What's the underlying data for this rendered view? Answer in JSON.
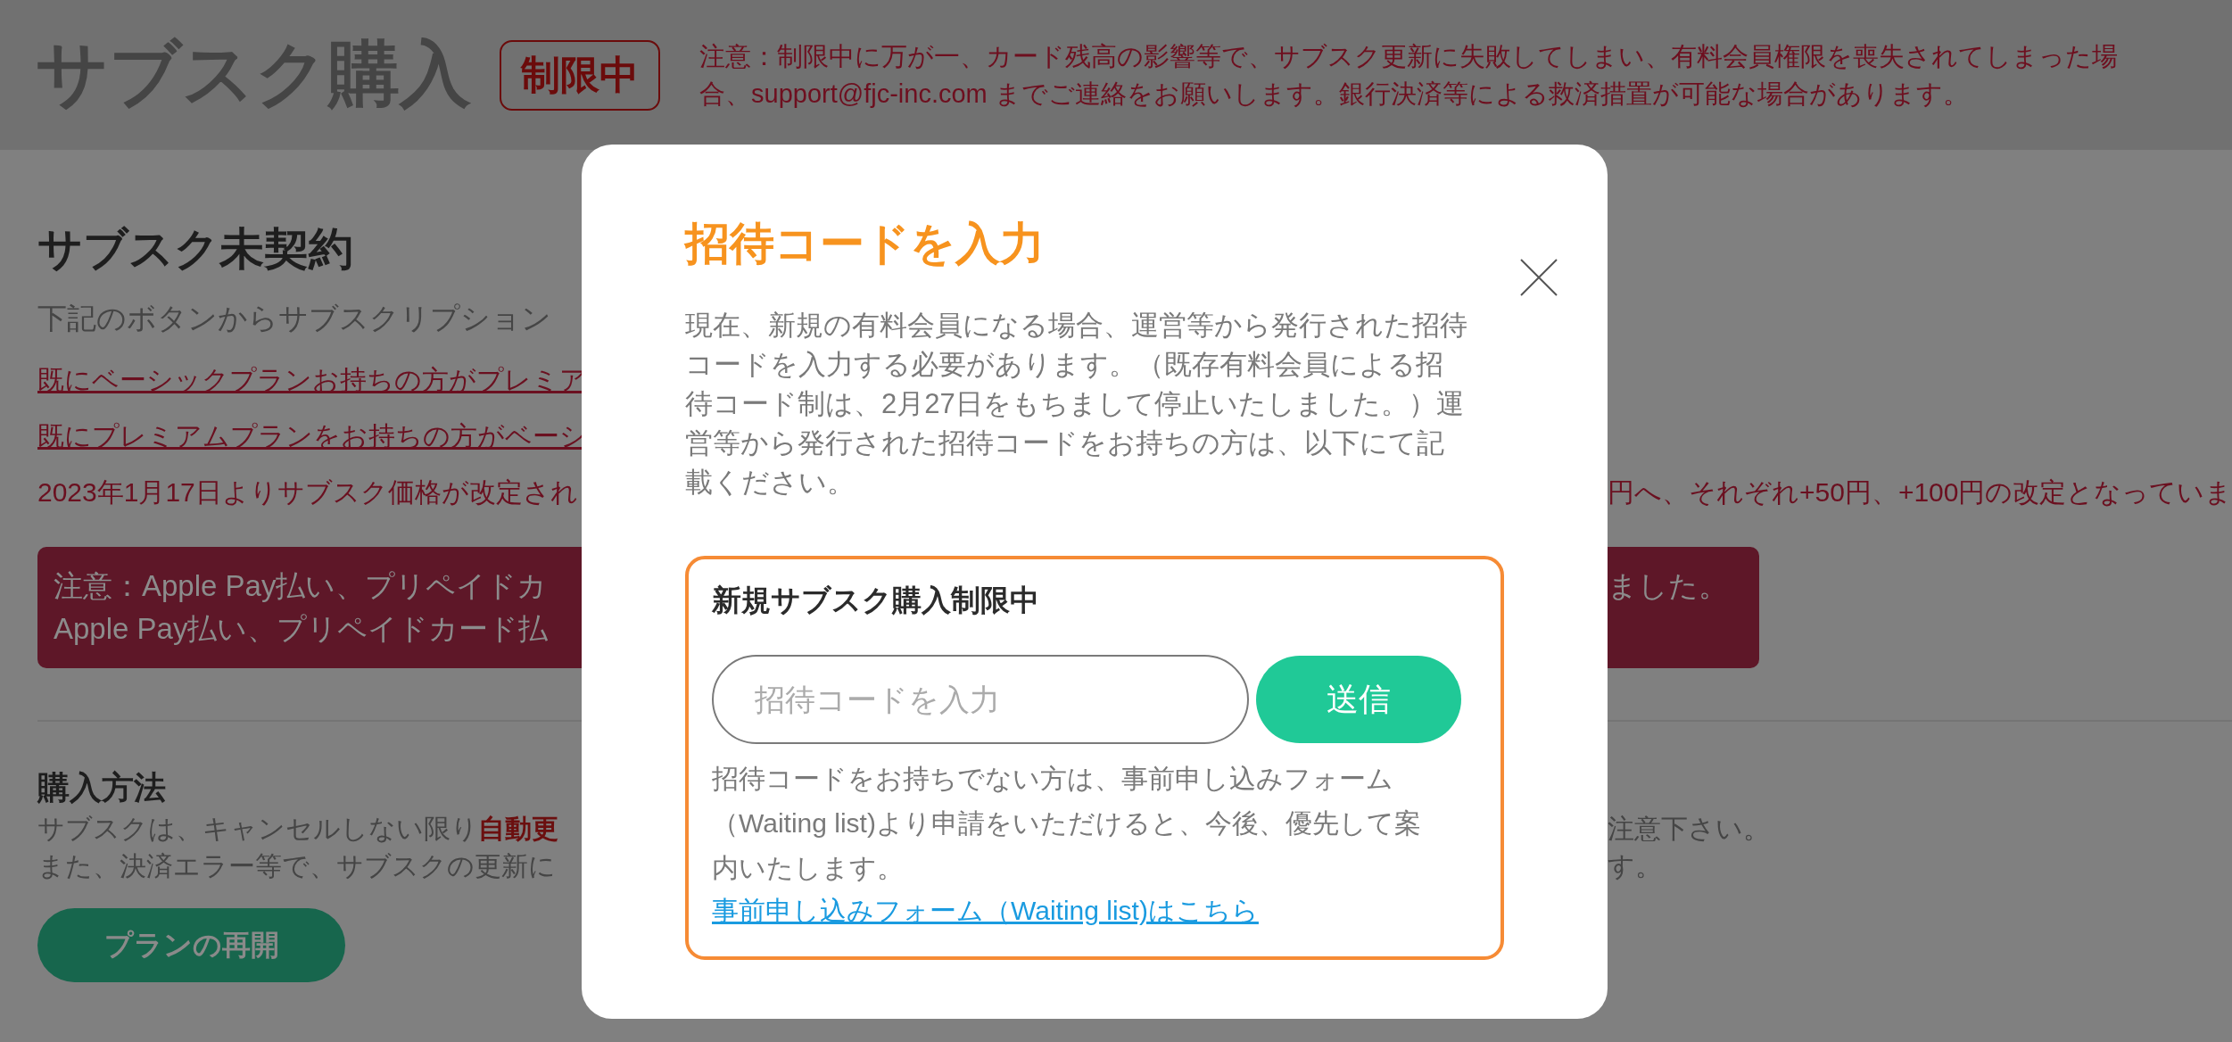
{
  "header": {
    "title": "サブスク購入",
    "badge": "制限中",
    "notice": "注意：制限中に万が一、カード残高の影響等で、サブスク更新に失敗してしまい、有料会員権限を喪失されてしまった場合、support@fjc-inc.com までご連絡をお願いします。銀行決済等による救済措置が可能な場合があります。"
  },
  "main": {
    "heading": "サブスク未契約",
    "intro": "下記のボタンからサブスクリプション",
    "links": [
      "既にベーシックプランお持ちの方がプレミア",
      "既にプレミアムプランをお持ちの方がベーシ"
    ],
    "price_notice": {
      "left": "2023年1月17日よりサブスク価格が改定され",
      "right": "円へ、それぞれ+50円、+100円の改定となっていま"
    },
    "alert": {
      "lines": [
        {
          "left": "注意：Apple Pay払い、プリペイドカ",
          "right": "ました。"
        },
        {
          "left": "Apple Pay払い、プリペイドカード払"
        }
      ]
    },
    "purchase": {
      "heading": "購入方法",
      "lines": [
        {
          "left": "サブスクは、キャンセルしない限り**自動更**",
          "right": "注意下さい。"
        },
        {
          "left": "また、決済エラー等で、サブスクの更新に",
          "right": "す。"
        }
      ],
      "button": "プランの再開"
    }
  },
  "modal": {
    "title": "招待コードを入力",
    "description": "現在、新規の有料会員になる場合、運営等から発行された招待コードを入力する必要があります。（既存有料会員による招待コード制は、2月27日をもちまして停止いたしました。）運営等から発行された招待コードをお持ちの方は、以下にて記載ください。",
    "box": {
      "heading": "新規サブスク購入制限中",
      "code_field": {
        "placeholder": "招待コードを入力"
      },
      "submit": "送信",
      "note": "招待コードをお持ちでない方は、事前申し込みフォーム（Waiting list)より申請をいただけると、今後、優先して案内いたします。",
      "link": "事前申し込みフォーム（Waiting list)はこちら"
    }
  }
}
